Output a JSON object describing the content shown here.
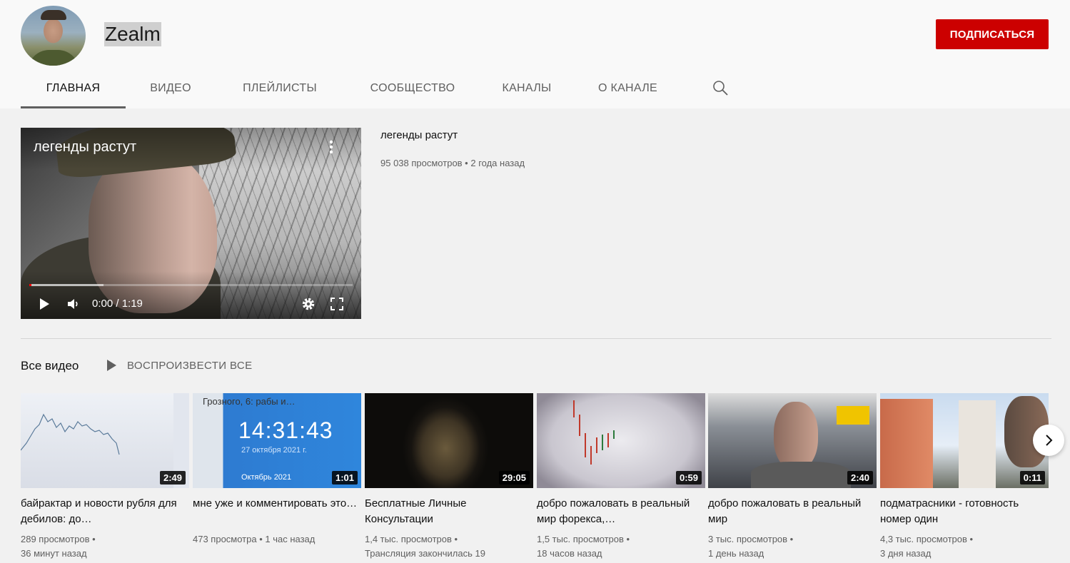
{
  "channel": {
    "name": "Zealm",
    "subscribe_label": "ПОДПИСАТЬСЯ"
  },
  "tabs": [
    {
      "label": "ГЛАВНАЯ",
      "active": true
    },
    {
      "label": "ВИДЕО",
      "active": false
    },
    {
      "label": "ПЛЕЙЛИСТЫ",
      "active": false
    },
    {
      "label": "СООБЩЕСТВО",
      "active": false
    },
    {
      "label": "КАНАЛЫ",
      "active": false
    },
    {
      "label": "О КАНАЛЕ",
      "active": false
    }
  ],
  "featured": {
    "overlay_title": "легенды растут",
    "title": "легенды растут",
    "meta": "95 038 просмотров • 2 года назад",
    "time": "0:00 / 1:19",
    "buffered_fraction": 0.23,
    "played_fraction": 0.0
  },
  "shelf": {
    "title": "Все видео",
    "play_all_label": "ВОСПРОИЗВЕСТИ ВСЕ",
    "videos": [
      {
        "title": "байрактар и новости рубля для дебилов: до…",
        "duration": "2:49",
        "views": "289 просмотров •",
        "age": "36 минут назад"
      },
      {
        "title": "мне уже и комментировать это…",
        "duration": "1:01",
        "views": "473 просмотра • 1 час назад",
        "age": ""
      },
      {
        "title": "Бесплатные Личные Консультации",
        "duration": "29:05",
        "views": "1,4 тыс. просмотров •",
        "age": "Трансляция закончилась 19"
      },
      {
        "title": "добро пожаловать в реальный мир форекса,…",
        "duration": "0:59",
        "views": "1,5 тыс. просмотров •",
        "age": "18 часов назад"
      },
      {
        "title": "добро пожаловать в реальный мир",
        "duration": "2:40",
        "views": "3 тыс. просмотров •",
        "age": "1 день назад"
      },
      {
        "title": "подматрасники - готовность номер один",
        "duration": "0:11",
        "views": "4,3 тыс. просмотров •",
        "age": "3 дня назад"
      }
    ]
  },
  "thumb_text": {
    "clock_header": "Грозного, 6: рабы и…",
    "clock_time": "14:31:43",
    "clock_date": "27 октября 2021 г.",
    "clock_month": "Октябрь 2021"
  },
  "colors": {
    "subscribe": "#cc0000",
    "progress": "#ff0000"
  }
}
